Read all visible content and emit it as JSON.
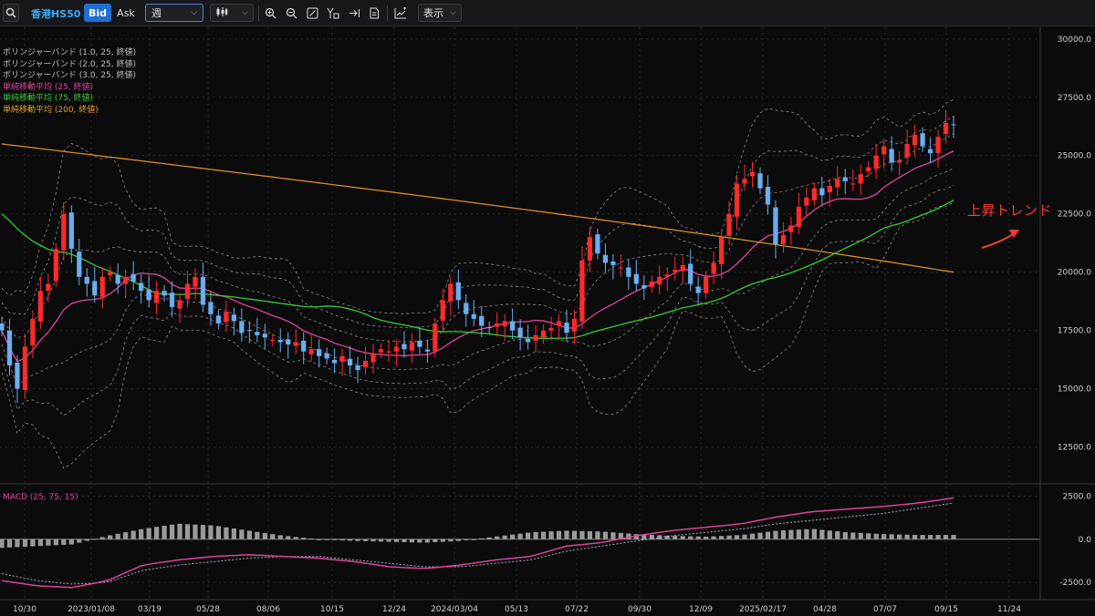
{
  "toolbar": {
    "symbol": "香港HS50",
    "bid_label": "Bid",
    "ask_label": "Ask",
    "period_value": "週",
    "display_label": "表示",
    "icons": [
      "search-icon",
      "candlestick-type-icon",
      "zoom-in-icon",
      "zoom-out-icon",
      "fit-icon",
      "drawing-icon",
      "jump-to-latest-icon",
      "document-icon",
      "add-indicator-icon"
    ]
  },
  "legend": [
    {
      "text": "ボリンジャーバンド (1.0, 25, 終値)",
      "color": "#bdbdbd"
    },
    {
      "text": "ボリンジャーバンド (2.0, 25, 終値)",
      "color": "#bdbdbd"
    },
    {
      "text": "ボリンジャーバンド (3.0, 25, 終値)",
      "color": "#bdbdbd"
    },
    {
      "text": "単純移動平均 (25, 終値)",
      "color": "#e0429a"
    },
    {
      "text": "単純移動平均 (75, 終値)",
      "color": "#33cc33"
    },
    {
      "text": "単純移動平均 (200, 終値)",
      "color": "#e0a030"
    }
  ],
  "macd_label": "MACD (25, 75, 15)",
  "annotation": "上昇トレンド",
  "colors": {
    "up": "#ff2a2a",
    "down": "#6aaef0",
    "sma25": "#e0429a",
    "sma75": "#33cc33",
    "sma200": "#d98e1e",
    "band": "#8a8a8a",
    "macd": "#e0429a",
    "signal": "#a8b4c8",
    "hist": "#9a9a9a"
  },
  "chart_data": [
    {
      "type": "candlestick",
      "title": "香港HS50",
      "period": "週",
      "ylim": [
        11000,
        30500
      ],
      "y_ticks": [
        "30000.0",
        "27500.0",
        "25000.0",
        "22500.0",
        "20000.0",
        "17500.0",
        "15000.0",
        "12500.0"
      ],
      "y_tick_values": [
        30000,
        27500,
        25000,
        22500,
        20000,
        17500,
        15000,
        12500
      ],
      "x_ticks": [
        "10/30",
        "2023/01/08",
        "03/19",
        "05/28",
        "08/06",
        "10/15",
        "12/24",
        "2024/03/04",
        "05/13",
        "07/22",
        "09/30",
        "12/09",
        "2025/02/17",
        "04/28",
        "07/07",
        "09/15",
        "11/24"
      ],
      "close_path": [
        17500,
        16000,
        15000,
        16800,
        18000,
        19200,
        19500,
        21000,
        22500,
        21000,
        19800,
        19500,
        19000,
        19800,
        20000,
        19500,
        19800,
        19600,
        19200,
        18800,
        19200,
        19000,
        18500,
        18800,
        19500,
        19800,
        18600,
        18200,
        17800,
        18300,
        17900,
        17400,
        17500,
        17300,
        17200,
        17100,
        17000,
        16900,
        17000,
        16600,
        16700,
        16400,
        16300,
        16100,
        16400,
        16000,
        15800,
        16200,
        16500,
        16700,
        16600,
        16800,
        16700,
        17000,
        16800,
        16600,
        17800,
        18800,
        19500,
        18800,
        18200,
        18000,
        17700,
        17600,
        17800,
        17900,
        17500,
        17200,
        17000,
        17300,
        17500,
        17600,
        17900,
        17400,
        18000,
        20500,
        21500,
        20800,
        20400,
        20300,
        20200,
        19800,
        19500,
        19300,
        19600,
        19800,
        19900,
        20100,
        20300,
        19500,
        19100,
        19800,
        20400,
        21500,
        22500,
        23800,
        24000,
        24300,
        23600,
        22900,
        21200,
        21600,
        22000,
        22800,
        23200,
        23600,
        23300,
        23700,
        24000,
        23900,
        23800,
        24200,
        24500,
        25000,
        25400,
        24700,
        24800,
        25500,
        25900,
        25400,
        25100,
        25800,
        26400,
        26300
      ],
      "sma_200_endpoints": [
        25500,
        20000
      ],
      "sma_75_endpoints": [
        22500,
        21100
      ],
      "annotation": "上昇トレンド"
    },
    {
      "type": "macd",
      "title": "MACD (25, 75, 15)",
      "ylim": [
        -3500,
        3000
      ],
      "y_ticks": [
        "2500.0",
        "0.0",
        "-2500.0"
      ],
      "y_tick_values": [
        2500,
        0,
        -2500
      ],
      "macd_path": [
        -2400,
        -2700,
        -2800,
        -2400,
        -1500,
        -1200,
        -1000,
        -900,
        -1000,
        -1100,
        -1300,
        -1600,
        -1700,
        -1500,
        -1200,
        -1000,
        -400,
        -200,
        200,
        500,
        700,
        900,
        1300,
        1600,
        1750,
        1900,
        2100,
        2400
      ],
      "signal_path": [
        -2000,
        -2400,
        -2600,
        -2500,
        -1800,
        -1500,
        -1300,
        -1100,
        -1000,
        -1000,
        -1200,
        -1400,
        -1600,
        -1600,
        -1400,
        -1200,
        -700,
        -400,
        -100,
        200,
        400,
        600,
        900,
        1100,
        1300,
        1500,
        1800,
        2100
      ],
      "histogram_path": [
        -500,
        -400,
        -300,
        200,
        600,
        900,
        800,
        500,
        200,
        0,
        -100,
        -150,
        -200,
        -100,
        150,
        400,
        500,
        450,
        300,
        200,
        150,
        250,
        500,
        600,
        400,
        300,
        250,
        250
      ]
    }
  ]
}
